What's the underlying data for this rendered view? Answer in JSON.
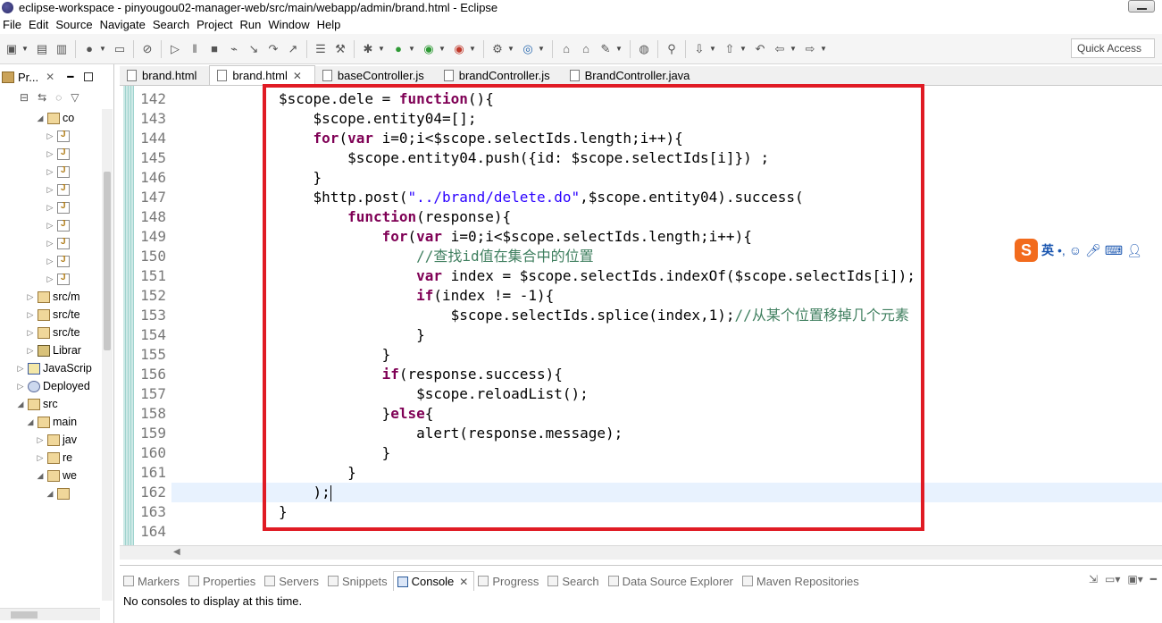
{
  "window": {
    "title": "eclipse-workspace - pinyougou02-manager-web/src/main/webapp/admin/brand.html - Eclipse"
  },
  "menu": [
    "File",
    "Edit",
    "Source",
    "Navigate",
    "Search",
    "Project",
    "Run",
    "Window",
    "Help"
  ],
  "toolbar": {
    "quick_access": "Quick Access"
  },
  "left_panel": {
    "tab_label": "Pr...",
    "tree": [
      {
        "depth": 4,
        "arrow": "◢",
        "icon": "pkg",
        "label": "co"
      },
      {
        "depth": 5,
        "arrow": "▷",
        "icon": "file",
        "label": ""
      },
      {
        "depth": 5,
        "arrow": "▷",
        "icon": "file",
        "label": ""
      },
      {
        "depth": 5,
        "arrow": "▷",
        "icon": "file",
        "label": ""
      },
      {
        "depth": 5,
        "arrow": "▷",
        "icon": "file",
        "label": ""
      },
      {
        "depth": 5,
        "arrow": "▷",
        "icon": "file",
        "label": ""
      },
      {
        "depth": 5,
        "arrow": "▷",
        "icon": "file",
        "label": ""
      },
      {
        "depth": 5,
        "arrow": "▷",
        "icon": "file",
        "label": ""
      },
      {
        "depth": 5,
        "arrow": "▷",
        "icon": "file",
        "label": ""
      },
      {
        "depth": 5,
        "arrow": "▷",
        "icon": "file",
        "label": ""
      },
      {
        "depth": 3,
        "arrow": "▷",
        "icon": "pkg",
        "label": "src/m"
      },
      {
        "depth": 3,
        "arrow": "▷",
        "icon": "pkg",
        "label": "src/te"
      },
      {
        "depth": 3,
        "arrow": "▷",
        "icon": "pkg",
        "label": "src/te"
      },
      {
        "depth": 3,
        "arrow": "▷",
        "icon": "lib",
        "label": "Librar"
      },
      {
        "depth": 2,
        "arrow": "▷",
        "icon": "js",
        "label": "JavaScrip"
      },
      {
        "depth": 2,
        "arrow": "▷",
        "icon": "dep",
        "label": "Deployed"
      },
      {
        "depth": 2,
        "arrow": "◢",
        "icon": "pkg",
        "label": "src"
      },
      {
        "depth": 3,
        "arrow": "◢",
        "icon": "pkg",
        "label": "main"
      },
      {
        "depth": 4,
        "arrow": "▷",
        "icon": "pkg",
        "label": "jav"
      },
      {
        "depth": 4,
        "arrow": "▷",
        "icon": "pkg",
        "label": "re"
      },
      {
        "depth": 4,
        "arrow": "◢",
        "icon": "pkg",
        "label": "we"
      },
      {
        "depth": 5,
        "arrow": "◢",
        "icon": "pkg",
        "label": ""
      }
    ]
  },
  "editor_tabs": [
    {
      "label": "brand.html",
      "active": false,
      "closable": false
    },
    {
      "label": "brand.html",
      "active": true,
      "closable": true
    },
    {
      "label": "baseController.js",
      "active": false,
      "closable": false
    },
    {
      "label": "brandController.js",
      "active": false,
      "closable": false
    },
    {
      "label": "BrandController.java",
      "active": false,
      "closable": false
    }
  ],
  "editor": {
    "line_numbers": [
      "142",
      "143",
      "144",
      "145",
      "146",
      "147",
      "148",
      "149",
      "150",
      "151",
      "152",
      "153",
      "154",
      "155",
      "156",
      "157",
      "158",
      "159",
      "160",
      "161",
      "162",
      "163",
      "164"
    ],
    "lines": [
      [
        {
          "t": "$scope.dele = "
        },
        {
          "t": "function",
          "c": "kw"
        },
        {
          "t": "(){"
        }
      ],
      [
        {
          "t": "    $scope.entity04=[];"
        }
      ],
      [
        {
          "t": "    "
        },
        {
          "t": "for",
          "c": "kw"
        },
        {
          "t": "("
        },
        {
          "t": "var",
          "c": "kw"
        },
        {
          "t": " i=0;i<$scope.selectIds.length;i++){"
        }
      ],
      [
        {
          "t": "        $scope.entity04.push({id: $scope.selectIds[i]}) ;"
        }
      ],
      [
        {
          "t": "    }"
        }
      ],
      [
        {
          "t": "    $http.post("
        },
        {
          "t": "\"../brand/delete.do\"",
          "c": "str"
        },
        {
          "t": ",$scope.entity04).success("
        }
      ],
      [
        {
          "t": "        "
        },
        {
          "t": "function",
          "c": "kw"
        },
        {
          "t": "(response){"
        }
      ],
      [
        {
          "t": "            "
        },
        {
          "t": "for",
          "c": "kw"
        },
        {
          "t": "("
        },
        {
          "t": "var",
          "c": "kw"
        },
        {
          "t": " i=0;i<$scope.selectIds.length;i++){"
        }
      ],
      [
        {
          "t": "                "
        },
        {
          "t": "//查找id值在集合中的位置",
          "c": "cmt"
        }
      ],
      [
        {
          "t": "                "
        },
        {
          "t": "var",
          "c": "kw"
        },
        {
          "t": " index = $scope.selectIds.indexOf($scope.selectIds[i]);"
        }
      ],
      [
        {
          "t": "                "
        },
        {
          "t": "if",
          "c": "kw"
        },
        {
          "t": "(index != -1){"
        }
      ],
      [
        {
          "t": "                    $scope.selectIds.splice(index,1);"
        },
        {
          "t": "//从某个位置移掉几个元素",
          "c": "cmt"
        }
      ],
      [
        {
          "t": "                }"
        }
      ],
      [
        {
          "t": "            }"
        }
      ],
      [
        {
          "t": "            "
        },
        {
          "t": "if",
          "c": "kw"
        },
        {
          "t": "(response.success){"
        }
      ],
      [
        {
          "t": "                $scope.reloadList();"
        }
      ],
      [
        {
          "t": "            }"
        },
        {
          "t": "else",
          "c": "kw"
        },
        {
          "t": "{"
        }
      ],
      [
        {
          "t": "                alert(response.message);"
        }
      ],
      [
        {
          "t": "            }"
        }
      ],
      [
        {
          "t": "        }"
        }
      ],
      [
        {
          "t": "    );"
        },
        {
          "t": "|",
          "c": "caret"
        }
      ],
      [
        {
          "t": "}"
        }
      ],
      [
        {
          "t": ""
        }
      ]
    ],
    "highlight_color": "#e01b24"
  },
  "ime": {
    "logo": "S",
    "mode": "英"
  },
  "bottom_panel": {
    "tabs": [
      {
        "label": "Markers",
        "active": false
      },
      {
        "label": "Properties",
        "active": false
      },
      {
        "label": "Servers",
        "active": false
      },
      {
        "label": "Snippets",
        "active": false
      },
      {
        "label": "Console",
        "active": true
      },
      {
        "label": "Progress",
        "active": false
      },
      {
        "label": "Search",
        "active": false
      },
      {
        "label": "Data Source Explorer",
        "active": false
      },
      {
        "label": "Maven Repositories",
        "active": false
      }
    ],
    "message": "No consoles to display at this time."
  }
}
